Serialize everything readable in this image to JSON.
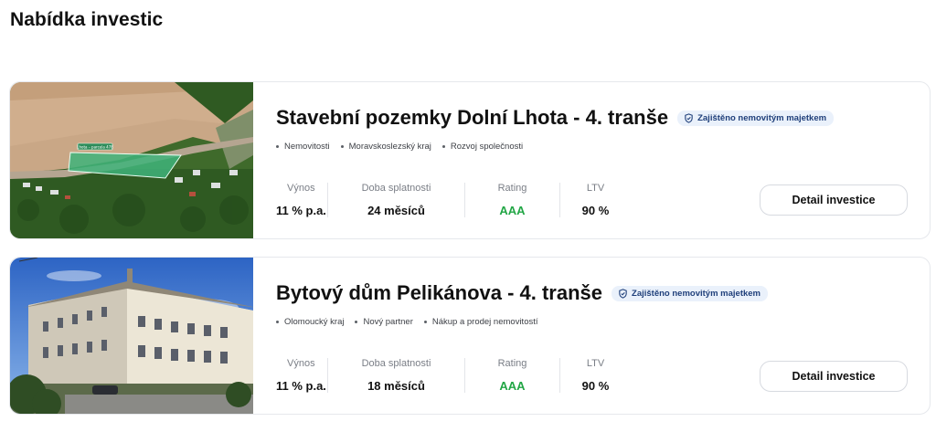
{
  "page": {
    "title": "Nabídka investic"
  },
  "investments": [
    {
      "title": "Stavební pozemky Dolní Lhota - 4. tranše",
      "badge": "Zajištěno nemovitým majetkem",
      "tags": [
        "Nemovitosti",
        "Moravskoslezský kraj",
        "Rozvoj společnosti"
      ],
      "stats": {
        "yield_label": "Výnos",
        "yield_value": "11 % p.a.",
        "term_label": "Doba splatnosti",
        "term_value": "24 měsíců",
        "rating_label": "Rating",
        "rating_value": "AAA",
        "ltv_label": "LTV",
        "ltv_value": "90 %"
      },
      "button_label": "Detail investice",
      "image_label": "Lhota – parcela 478"
    },
    {
      "title": "Bytový dům Pelikánova - 4. tranše",
      "badge": "Zajištěno nemovitým majetkem",
      "tags": [
        "Olomoucký kraj",
        "Nový partner",
        "Nákup a prodej nemovitostí"
      ],
      "stats": {
        "yield_label": "Výnos",
        "yield_value": "11 % p.a.",
        "term_label": "Doba splatnosti",
        "term_value": "18 měsíců",
        "rating_label": "Rating",
        "rating_value": "AAA",
        "ltv_label": "LTV",
        "ltv_value": "90 %"
      },
      "button_label": "Detail investice"
    }
  ],
  "colors": {
    "rating_green": "#22a645",
    "badge_bg": "#eaf1fb",
    "badge_text": "#1f3f7a"
  },
  "icons": {
    "badge_icon": "shield-check-icon"
  }
}
